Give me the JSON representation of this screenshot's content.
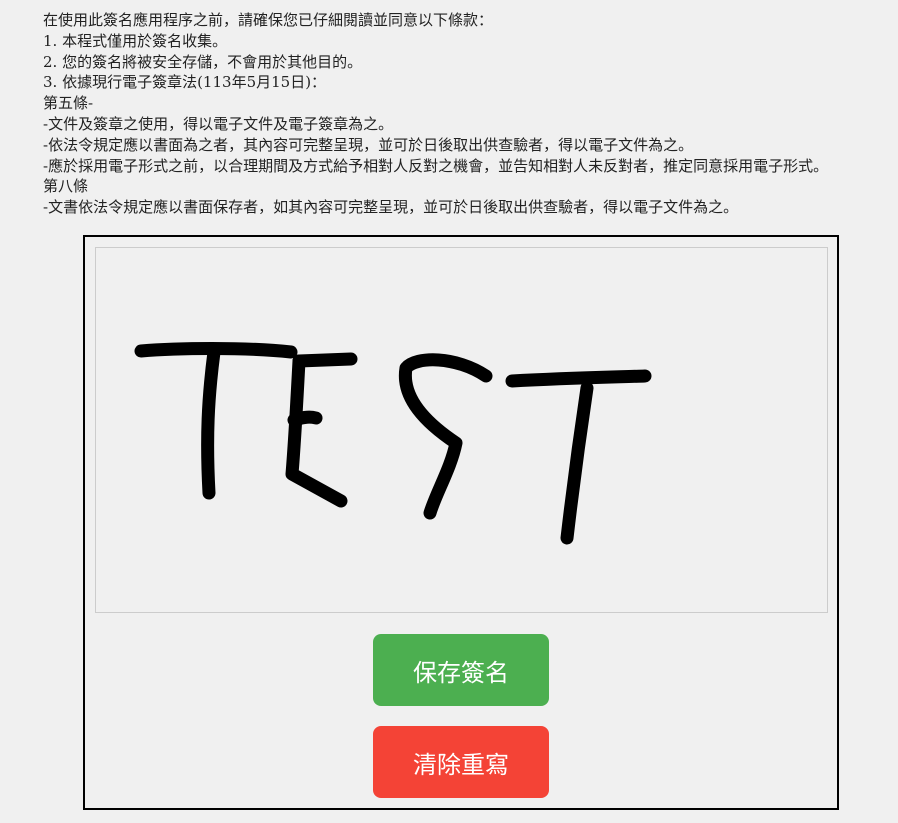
{
  "terms": {
    "lines": [
      "在使用此簽名應用程序之前，請確保您已仔細閱讀並同意以下條款：",
      "1. 本程式僅用於簽名收集。",
      "2. 您的簽名將被安全存儲，不會用於其他目的。",
      "3. 依據現行電子簽章法(113年5月15日)：",
      "第五條-",
      "-文件及簽章之使用，得以電子文件及電子簽章為之。",
      "-依法令規定應以書面為之者，其內容可完整呈現，並可於日後取出供查驗者，得以電子文件為之。",
      "-應於採用電子形式之前，以合理期間及方式給予相對人反對之機會，並告知相對人未反對者，推定同意採用電子形式。",
      "第八條",
      "-文書依法令規定應以書面保存者，如其內容可完整呈現，並可於日後取出供查驗者，得以電子文件為之。"
    ]
  },
  "signature_pad": {
    "content": "TEST",
    "stroke_color": "#000000"
  },
  "buttons": {
    "save_label": "保存簽名",
    "clear_label": "清除重寫",
    "save_color": "#4caf50",
    "clear_color": "#f44336"
  }
}
